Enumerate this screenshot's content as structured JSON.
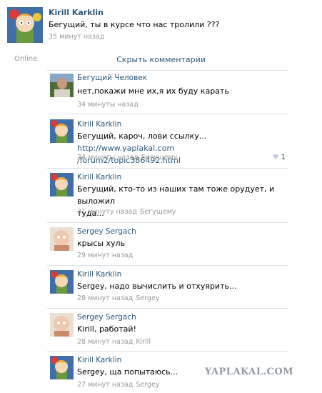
{
  "post": {
    "author": "Kirill Karklin",
    "text": "Бегущий, ты в курсе что нас тролили ???",
    "time": "35 минут назад",
    "status": "Online"
  },
  "hide_comments_label": "Скрыть комментарии",
  "comments": [
    {
      "author": "Бегущий Человек",
      "avatar": "man-photo-avatar",
      "text": "нет,покажи мне их,я их буду карать",
      "time": "34 минуты назад"
    },
    {
      "author": "Kirill Karklin",
      "avatar": "cartoon-avatar",
      "text_before": "Бегущий, кароч, лови ссылку... ",
      "link": "http://www.yaplakal.com/forum2/topic386492.html",
      "link_line1": "http://www.yaplakal.com",
      "link_line2": "/forum2/topic386492.html",
      "time": "34 минуты назад",
      "reply_to": "Бегущему",
      "likes": "1"
    },
    {
      "author": "Kirill Karklin",
      "avatar": "cartoon-avatar",
      "text_line1": "Бегущий, кто-то из наших там тоже орудует, и выложил",
      "text_line2": "туда...",
      "time": "31 минуту назад",
      "reply_to": "Бегущему"
    },
    {
      "author": "Sergey Sergach",
      "avatar": "cartoon-avatar-pink",
      "text": "крысы хуль",
      "time": "29 минут назад"
    },
    {
      "author": "Kirill Karklin",
      "avatar": "cartoon-avatar",
      "text": "Sergey, надо вычислить и отхуярить...",
      "time": "28 минут назад",
      "reply_to": "Sergey"
    },
    {
      "author": "Sergey Sergach",
      "avatar": "cartoon-avatar-pink",
      "text": "Kirill, работай!",
      "time": "28 минут назад",
      "reply_to": "Kirill"
    },
    {
      "author": "Kirill Karklin",
      "avatar": "cartoon-avatar",
      "text": "Sergey, ща попытаюсь...",
      "time": "27 минут назад",
      "reply_to": "Sergey"
    }
  ],
  "watermark": "YAPLAKAL.COM"
}
